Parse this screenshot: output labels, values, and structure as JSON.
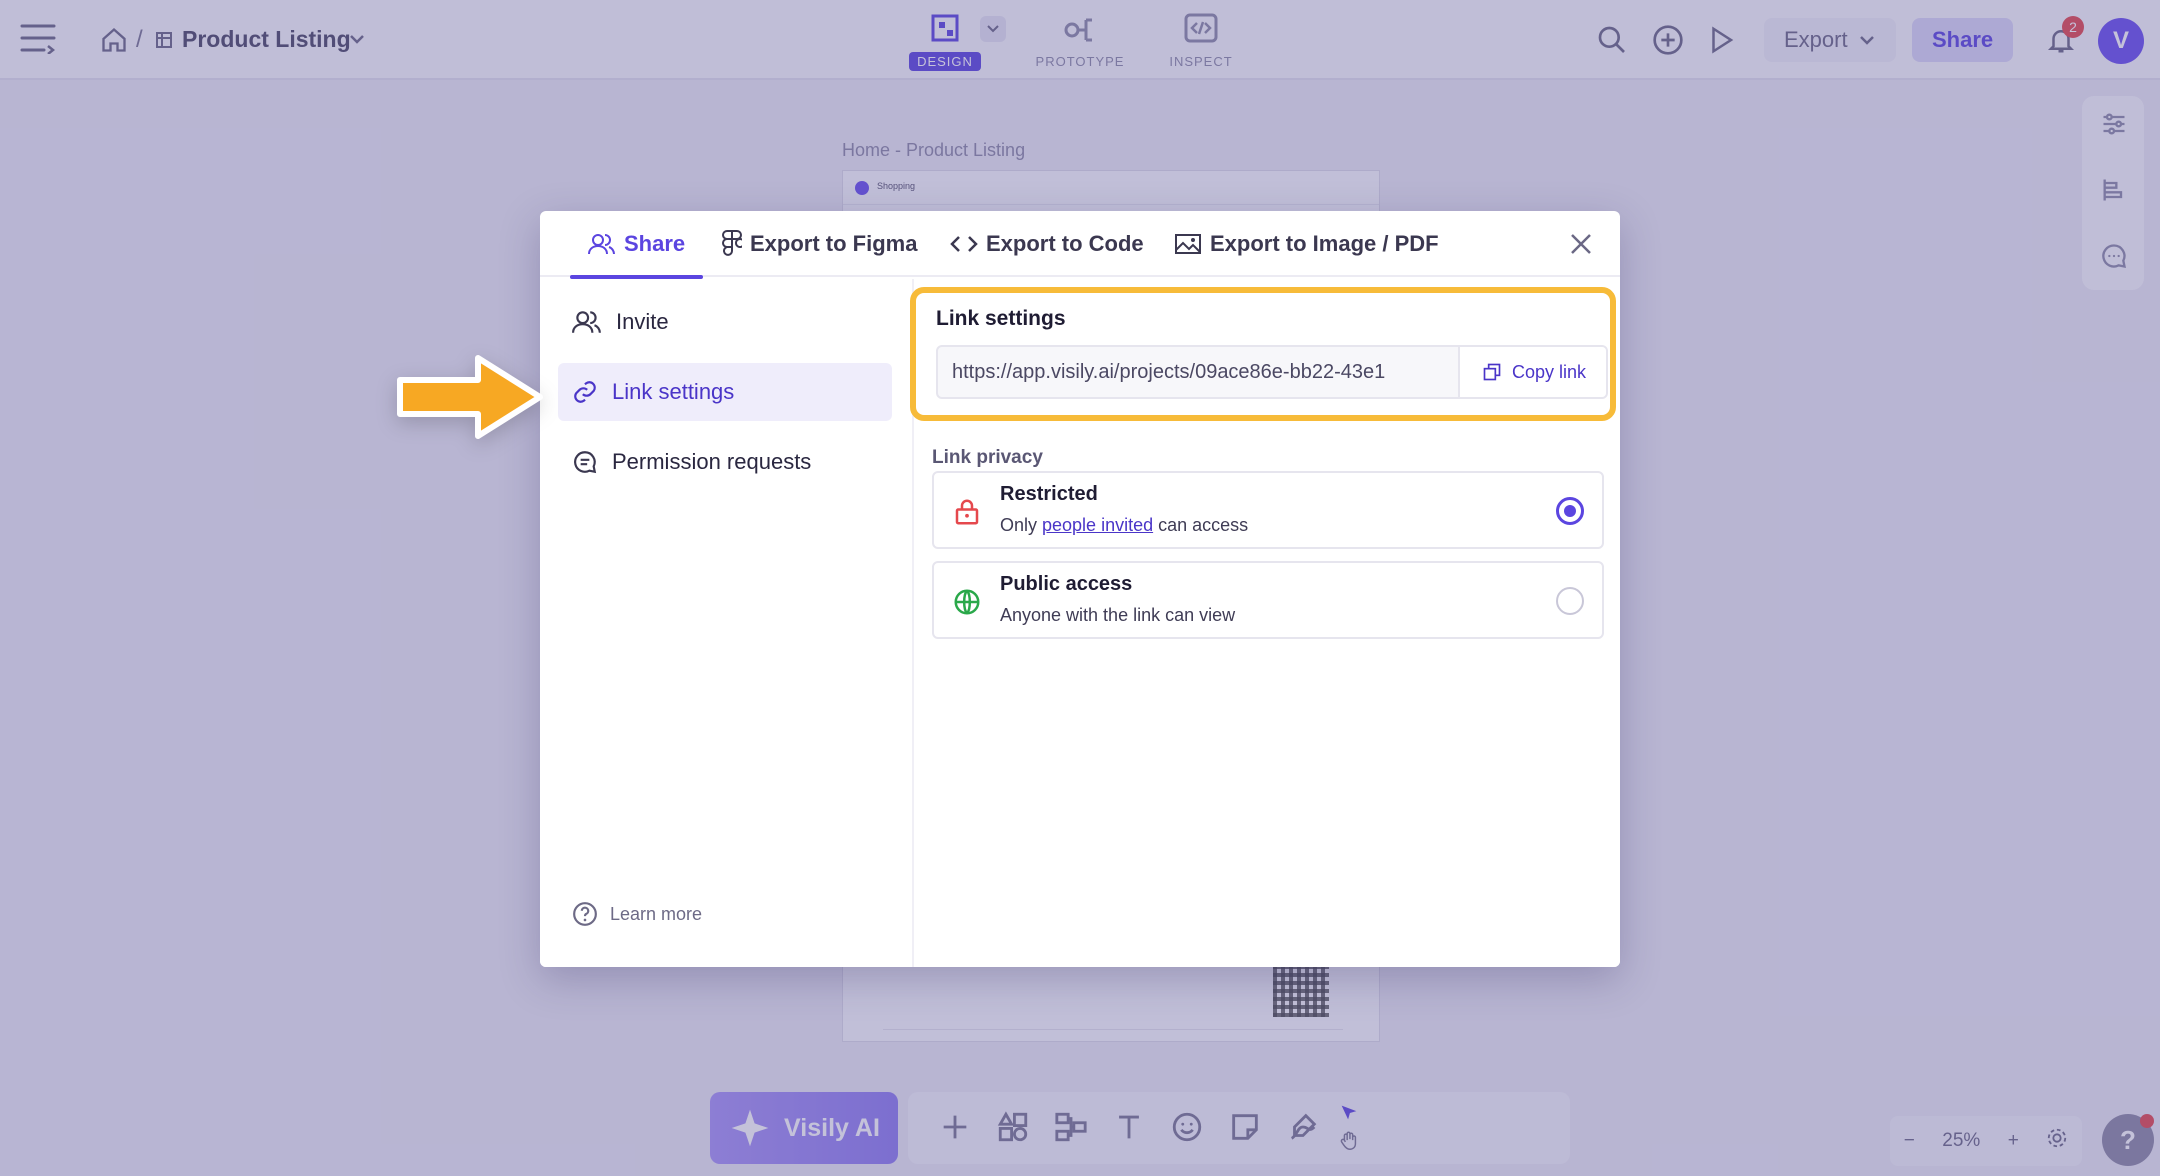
{
  "breadcrumb": {
    "title": "Product Listing"
  },
  "modes": [
    {
      "label": "DESIGN",
      "active": true
    },
    {
      "label": "PROTOTYPE",
      "active": false
    },
    {
      "label": "INSPECT",
      "active": false
    }
  ],
  "topbar": {
    "export_label": "Export",
    "share_label": "Share",
    "notifications": "2",
    "avatar_letter": "V"
  },
  "canvas": {
    "frame_label": "Home - Product Listing",
    "frame_header": "Shopping"
  },
  "bottom": {
    "ai_label": "Visily AI",
    "zoom": "25%",
    "help": "?"
  },
  "modal": {
    "tabs": [
      {
        "label": "Share",
        "icon": "users-icon",
        "active": true
      },
      {
        "label": "Export to Figma",
        "icon": "figma-icon"
      },
      {
        "label": "Export to Code",
        "icon": "code-icon"
      },
      {
        "label": "Export to Image / PDF",
        "icon": "image-icon"
      }
    ],
    "sidebar": [
      {
        "label": "Invite",
        "icon": "users-icon"
      },
      {
        "label": "Link settings",
        "icon": "link-icon",
        "active": true
      },
      {
        "label": "Permission requests",
        "icon": "chat-icon"
      }
    ],
    "learn_more": "Learn more",
    "link_settings": {
      "title": "Link settings",
      "url": "https://app.visily.ai/projects/09ace86e-bb22-43e1",
      "copy_label": "Copy link"
    },
    "privacy": {
      "title": "Link privacy",
      "options": [
        {
          "title": "Restricted",
          "desc_pre": "Only ",
          "desc_link": "people invited",
          "desc_post": " can access",
          "selected": true,
          "icon": "lock-icon"
        },
        {
          "title": "Public access",
          "desc": "Anyone with the link can view",
          "selected": false,
          "icon": "globe-icon"
        }
      ]
    }
  },
  "colors": {
    "accent": "#5B45E0",
    "highlight": "#F7BB39",
    "arrow": "#F7A823"
  }
}
